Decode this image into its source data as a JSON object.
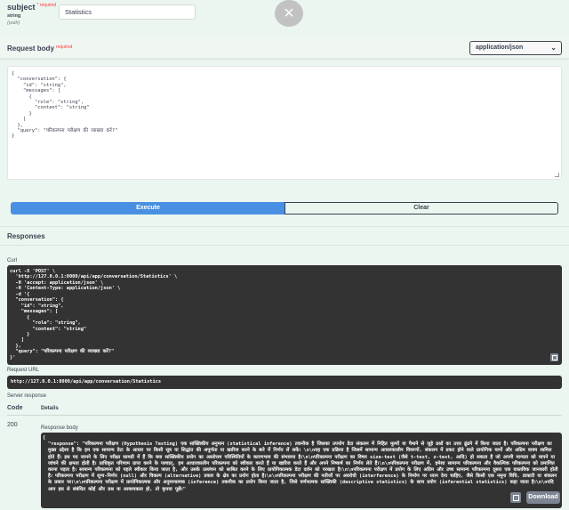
{
  "parameter": {
    "name": "subject",
    "required": "* required",
    "type": "string",
    "in": "(path)",
    "value": "Statistics"
  },
  "close_icon": "×",
  "request_body": {
    "label": "Request body",
    "required": "required",
    "content_type": "application/json",
    "caret": "⌄",
    "json": "{\n  \"conversation\": {\n    \"id\": \"string\",\n    \"messages\": [\n      {\n        \"role\": \"string\",\n        \"content\": \"string\"\n      }\n    ]\n  },\n  \"query\": \"परिकल्पना परीक्षण की व्याख्या करें?\"\n}"
  },
  "buttons": {
    "execute": "Execute",
    "clear": "Clear",
    "download": "Download"
  },
  "responses": {
    "title": "Responses",
    "curl_label": "Curl",
    "curl": "curl -X 'POST' \\\n  'http://127.0.0.1:8000/api/app/conversation/Statistics' \\\n  -H 'accept: application/json' \\\n  -H 'Content-Type: application/json' \\\n  -d '{\n  \"conversation\": {\n    \"id\": \"string\",\n    \"messages\": [\n      {\n        \"role\": \"string\",\n        \"content\": \"string\"\n      }\n    ]\n  },\n  \"query\": \"परिकल्पना परीक्षण की व्याख्या करें?\"\n}'",
    "request_url_label": "Request URL",
    "request_url": "http://127.0.0.1:8000/api/app/conversation/Statistics",
    "server_response_label": "Server response",
    "code_header": "Code",
    "details_header": "Details",
    "code": "200",
    "response_body_label": "Response body",
    "body_open": "{",
    "body_key": "\"response\":",
    "body_text": "\"परिकल्पना परीक्षण (Hypothesis Testing) एक सांख्यिकीय अनुमान (statistical inference) तकनीक है जिसका उपयोग डेटा संकलन में निहित मूल्यों या पैमाने से जुड़े प्रश्नों का उत्तर ढूंढने में किया जाता है। परिकल्पना परीक्षण का मुख्य उद्देश्य है कि हम एक सामान्य डेटा के आधार पर किसी सूत्र या सिद्धांत की अपूर्णता या खारिज करने के बारे में निर्णय लें सकें। \\n\\nयह एक प्रक्रिया है जिसमें सामान्य आधारकालीन विवरणों, संकलन में प्रकट होने वाले प्रायोगिक मानों और अग्रिम वाक्य शामिल होते हैं। इस पद जानने के लिए परीक्षा सामग्री में हैं कि क्या सांख्यिकीय प्रयोग का अस्तोत्तम परिस्थितियों के कारणभाव की संभावना है।\\n\\nपरिकल्पना परीक्षण का विषय size-test (जैसे t-test, z-test, आदि) हो सकता है जो अपनी मान्यता को मापने या जांचने की क्षमता होती है। प्राधिकृत परिणाम प्राप्त करने के पश्चात्, हम आधारकालीन परिकल्पना को स्वीकार करते हैं या खारिज करते हैं और अपने निष्कर्ष का निर्णय लेते हैं।\\n\\nपरिकल्पना परीक्षण में, हमेशा सामान्य परिकल्पना और वैकल्पिक परिकल्पना को प्रमाणित करना पड़ता है। सामान्य परिकल्पना को पहले स्वीकार किया जाता है, और उसके उल्लंघन को साबित करने के लिए प्रायोगिकात्मक डेटा दर्शन को परखता है।\\n\\nपरिकल्पना परीक्षण में प्रयोग के लिए अग्रिम और उच्च सामान्य परिकल्पना दूसरा एक वास्तविक जानकारी होती है। परिकल्पना परीक्षण में शून्य-निर्णय (null) और विकल्प (alternative) प्रकार के क्षेत्र का प्रयोग होता है।\\n\\nपरिकल्पना परीक्षण की नतीजों पर अवरोधी (interference) के निर्माण पर ध्यान देना चाहिए, जैसे किसी एक नमूना विधि, डाक्टरी या संकलन के प्रकार पर।\\n\\nपरिकल्पना परीक्षण में प्रायोगिकात्मक और अनुमानात्मक (inference) तकनीक का प्रयोग किया जाता है, जिसे वर्णनात्मक सांख्यिकी (descriptive statistics) के साथ प्रयोग (inferential statistics) कहा जाता है।\\n\\nयदि आप इस से संबंधित कोई और प्रश्न या आवश्यकता हो, तो कृपया पूछें।\""
  }
}
